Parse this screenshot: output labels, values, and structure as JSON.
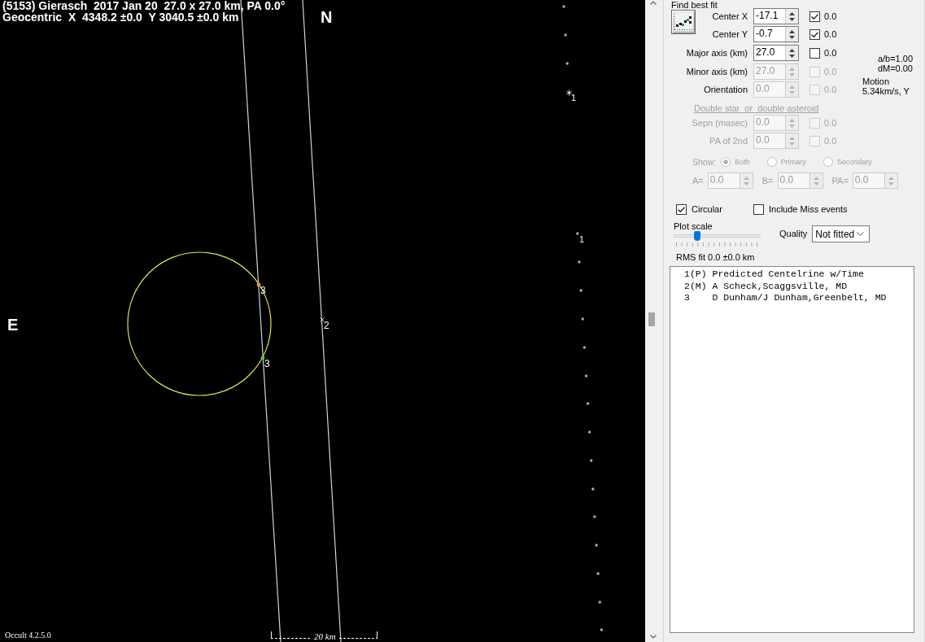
{
  "plot": {
    "title": "(5153) Gierasch  2017 Jan 20  27.0 x 27.0 km, PA 0.0°",
    "subtitle": "Geocentric  X  4348.2 ±0.0  Y 3040.5 ±0.0 km",
    "north_label": "N",
    "east_label": "E",
    "centerline_labels": [
      "1",
      "1"
    ],
    "chords": [
      {
        "kind": "positive",
        "events": [
          {
            "label": "3",
            "color": "#e8902c"
          },
          {
            "label": "3",
            "color": "#4ccc4c"
          }
        ]
      },
      {
        "kind": "miss",
        "events": [
          {
            "label": "2"
          }
        ]
      }
    ],
    "scale_label": "20 km",
    "version": "Occult 4.2.5.0"
  },
  "fit": {
    "title": "Find best fit",
    "params": [
      {
        "label": "Center X",
        "value": "-17.1",
        "checked": true,
        "result": "0.0",
        "disabled": false
      },
      {
        "label": "Center Y",
        "value": "-0.7",
        "checked": true,
        "result": "0.0",
        "disabled": false
      },
      {
        "label": "Major axis (km)",
        "value": "27.0",
        "checked": false,
        "result": "0.0",
        "disabled": false
      },
      {
        "label": "Minor axis (km)",
        "value": "27.0",
        "checked": false,
        "result": "0.0",
        "disabled": true
      },
      {
        "label": "Orientation",
        "value": "0.0",
        "checked": false,
        "result": "0.0",
        "disabled": true
      }
    ],
    "ratio": "a/b=1.00",
    "delta_mag": "dM=0.00",
    "motion_label": "Motion",
    "motion": "5.34km/s, Y"
  },
  "double_star": {
    "heading": "Double star  or  double asteroid",
    "disabled": true,
    "params": [
      {
        "label": "Sepn (masec)",
        "value": "0.0",
        "checked": false,
        "result": "0.0",
        "disabled": true
      },
      {
        "label": "PA of 2nd",
        "value": "0.0",
        "checked": false,
        "result": "0.0",
        "disabled": true
      }
    ],
    "show_label": "Show:",
    "show_options": [
      {
        "label": "Both",
        "selected": true
      },
      {
        "label": "Primary",
        "selected": false
      },
      {
        "label": "Secondary",
        "selected": false
      }
    ],
    "offsets": [
      {
        "label": "A=",
        "value": "0.0"
      },
      {
        "label": "B=",
        "value": "0.0"
      },
      {
        "label": "PA=",
        "value": "0.0"
      }
    ]
  },
  "circular": {
    "label": "Circular",
    "checked": true
  },
  "include_miss": {
    "label": "Include Miss events",
    "checked": false
  },
  "plot_scale": {
    "label": "Plot scale",
    "level": 0.25
  },
  "quality": {
    "label": "Quality",
    "value": "Not fitted"
  },
  "rms_fit": "RMS fit 0.0 ±0.0 km",
  "observers": [
    {
      "number": "1(P)",
      "name": "Predicted Centelrine w/Time"
    },
    {
      "number": "2(M)",
      "name": "A Scheck,Scaggsville, MD"
    },
    {
      "number": "3",
      "name": "D Dunham/J Dunham,Greenbelt, MD"
    }
  ]
}
